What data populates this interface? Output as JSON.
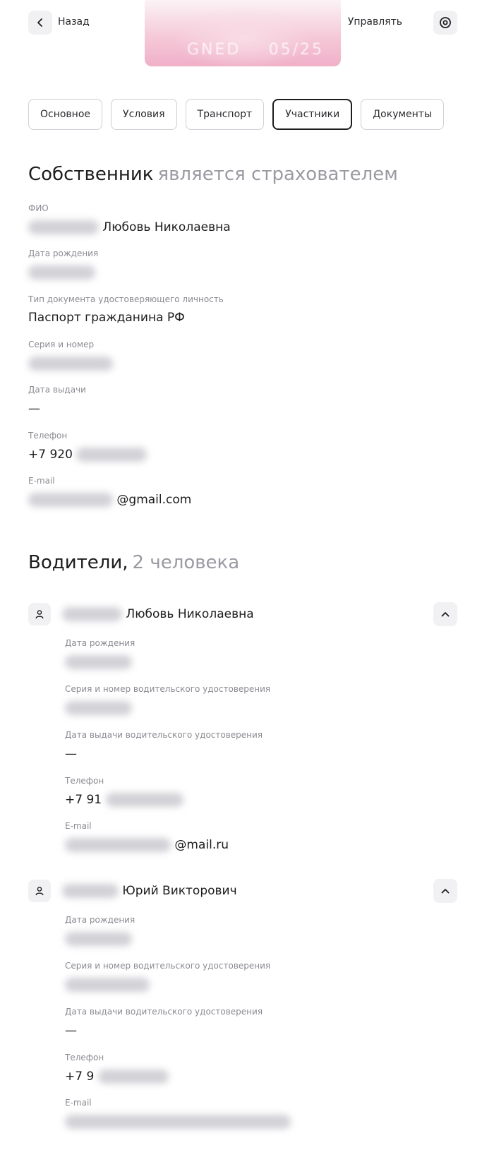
{
  "header": {
    "back_label": "Назад",
    "manage_label": "Управлять",
    "card_number": "GNED",
    "card_date": "05/25"
  },
  "tabs": [
    "Основное",
    "Условия",
    "Транспорт",
    "Участники",
    "Документы"
  ],
  "active_tab": "Участники",
  "owner": {
    "title": "Собственник",
    "subtitle": "является страхователем",
    "fields": {
      "fio_label": "ФИО",
      "fio_value": "Любовь Николаевна",
      "birth_label": "Дата рождения",
      "doctype_label": "Тип документа удостоверяющего личность",
      "doctype_value": "Паспорт гражданина РФ",
      "series_label": "Серия и номер",
      "issue_label": "Дата выдачи",
      "issue_value": "—",
      "phone_label": "Телефон",
      "phone_value": "+7 920",
      "email_label": "E-mail",
      "email_value": "@gmail.com"
    }
  },
  "drivers": {
    "title": "Водители,",
    "count": "2 человека",
    "items": [
      {
        "name": "Любовь Николаевна",
        "birth_label": "Дата рождения",
        "license_label": "Серия и номер водительского удостоверения",
        "license_issue_label": "Дата выдачи водительского удостоверения",
        "license_issue_value": "—",
        "phone_label": "Телефон",
        "phone_value": "+7 91",
        "email_label": "E-mail",
        "email_value": "@mail.ru"
      },
      {
        "name": "Юрий Викторович",
        "birth_label": "Дата рождения",
        "license_label": "Серия и номер водительского удостоверения",
        "license_issue_label": "Дата выдачи водительского удостоверения",
        "license_issue_value": "—",
        "phone_label": "Телефон",
        "phone_value": "+7 9",
        "email_label": "E-mail",
        "email_value": ""
      }
    ]
  },
  "icons": {
    "back": "chevron-left-icon",
    "manage": "settings-icon",
    "person": "person-icon",
    "collapse": "chevron-up-icon"
  }
}
